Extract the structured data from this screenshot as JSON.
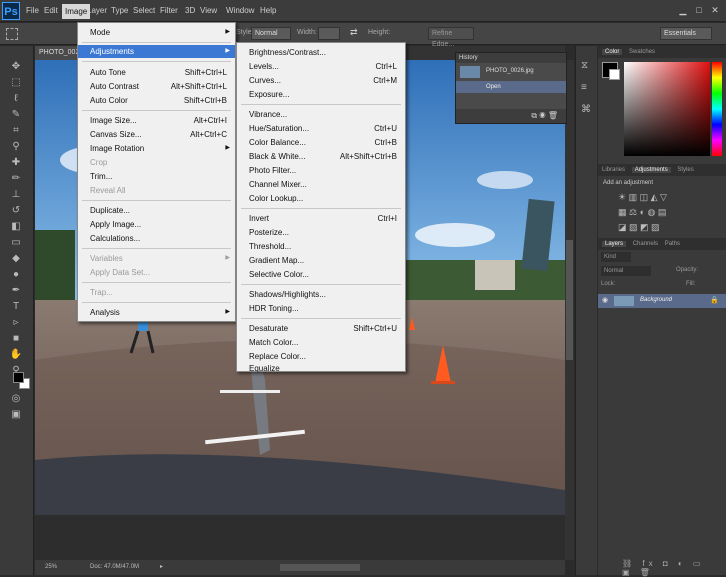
{
  "app": {
    "logo": "Ps"
  },
  "menubar": {
    "items": [
      "File",
      "Edit",
      "Image",
      "Layer",
      "Type",
      "Select",
      "Filter",
      "3D",
      "View",
      "Window",
      "Help"
    ],
    "active": "Image"
  },
  "window_buttons": {
    "minimize": "▁",
    "maximize": "□",
    "close": "✕"
  },
  "options_bar": {
    "style_label": "Style:",
    "style_value": "Normal",
    "width_label": "Width:",
    "height_label": "Height:",
    "refine_edge": "Refine Edge...",
    "workspace": "Essentials"
  },
  "document": {
    "tab": "PHOTO_002",
    "zoom": "25%",
    "doc_info": "Doc: 47.0M/47.0M"
  },
  "history": {
    "title": "History",
    "snapshot": "PHOTO_0026.jpg",
    "state": "Open"
  },
  "image_menu": {
    "items": [
      {
        "label": "Mode",
        "shortcut": "",
        "submenu": true
      },
      {
        "label": "Adjustments",
        "shortcut": "",
        "submenu": true,
        "highlight": true
      },
      {
        "label": "Auto Tone",
        "shortcut": "Shift+Ctrl+L"
      },
      {
        "label": "Auto Contrast",
        "shortcut": "Alt+Shift+Ctrl+L"
      },
      {
        "label": "Auto Color",
        "shortcut": "Shift+Ctrl+B"
      },
      {
        "label": "Image Size...",
        "shortcut": "Alt+Ctrl+I"
      },
      {
        "label": "Canvas Size...",
        "shortcut": "Alt+Ctrl+C"
      },
      {
        "label": "Image Rotation",
        "shortcut": "",
        "submenu": true
      },
      {
        "label": "Crop",
        "shortcut": "",
        "disabled": true
      },
      {
        "label": "Trim...",
        "shortcut": ""
      },
      {
        "label": "Reveal All",
        "shortcut": "",
        "disabled": true
      },
      {
        "label": "Duplicate...",
        "shortcut": ""
      },
      {
        "label": "Apply Image...",
        "shortcut": ""
      },
      {
        "label": "Calculations...",
        "shortcut": ""
      },
      {
        "label": "Variables",
        "shortcut": "",
        "submenu": true,
        "disabled": true
      },
      {
        "label": "Apply Data Set...",
        "shortcut": "",
        "disabled": true
      },
      {
        "label": "Trap...",
        "shortcut": "",
        "disabled": true
      },
      {
        "label": "Analysis",
        "shortcut": "",
        "submenu": true
      }
    ]
  },
  "adjustments_menu": {
    "items": [
      {
        "label": "Brightness/Contrast...",
        "shortcut": ""
      },
      {
        "label": "Levels...",
        "shortcut": "Ctrl+L"
      },
      {
        "label": "Curves...",
        "shortcut": "Ctrl+M"
      },
      {
        "label": "Exposure...",
        "shortcut": ""
      },
      {
        "label": "Vibrance...",
        "shortcut": ""
      },
      {
        "label": "Hue/Saturation...",
        "shortcut": "Ctrl+U"
      },
      {
        "label": "Color Balance...",
        "shortcut": "Ctrl+B"
      },
      {
        "label": "Black & White...",
        "shortcut": "Alt+Shift+Ctrl+B"
      },
      {
        "label": "Photo Filter...",
        "shortcut": ""
      },
      {
        "label": "Channel Mixer...",
        "shortcut": ""
      },
      {
        "label": "Color Lookup...",
        "shortcut": ""
      },
      {
        "label": "Invert",
        "shortcut": "Ctrl+I"
      },
      {
        "label": "Posterize...",
        "shortcut": ""
      },
      {
        "label": "Threshold...",
        "shortcut": ""
      },
      {
        "label": "Gradient Map...",
        "shortcut": ""
      },
      {
        "label": "Selective Color...",
        "shortcut": ""
      },
      {
        "label": "Shadows/Highlights...",
        "shortcut": ""
      },
      {
        "label": "HDR Toning...",
        "shortcut": ""
      },
      {
        "label": "Desaturate",
        "shortcut": "Shift+Ctrl+U"
      },
      {
        "label": "Match Color...",
        "shortcut": ""
      },
      {
        "label": "Replace Color...",
        "shortcut": ""
      },
      {
        "label": "Equalize",
        "shortcut": ""
      }
    ]
  },
  "color_panel": {
    "tabs": [
      "Color",
      "Swatches"
    ]
  },
  "adjustments_panel": {
    "tabs": [
      "Libraries",
      "Adjustments",
      "Styles"
    ],
    "heading": "Add an adjustment"
  },
  "layers_panel": {
    "tabs": [
      "Layers",
      "Channels",
      "Paths"
    ],
    "kind": "Kind",
    "blend_mode": "Normal",
    "opacity_label": "Opacity:",
    "lock_label": "Lock:",
    "fill_label": "Fill:",
    "layer_name": "Background"
  },
  "colors": {
    "accent": "#3b78d4",
    "foreground": "#000000",
    "background": "#ffffff"
  }
}
